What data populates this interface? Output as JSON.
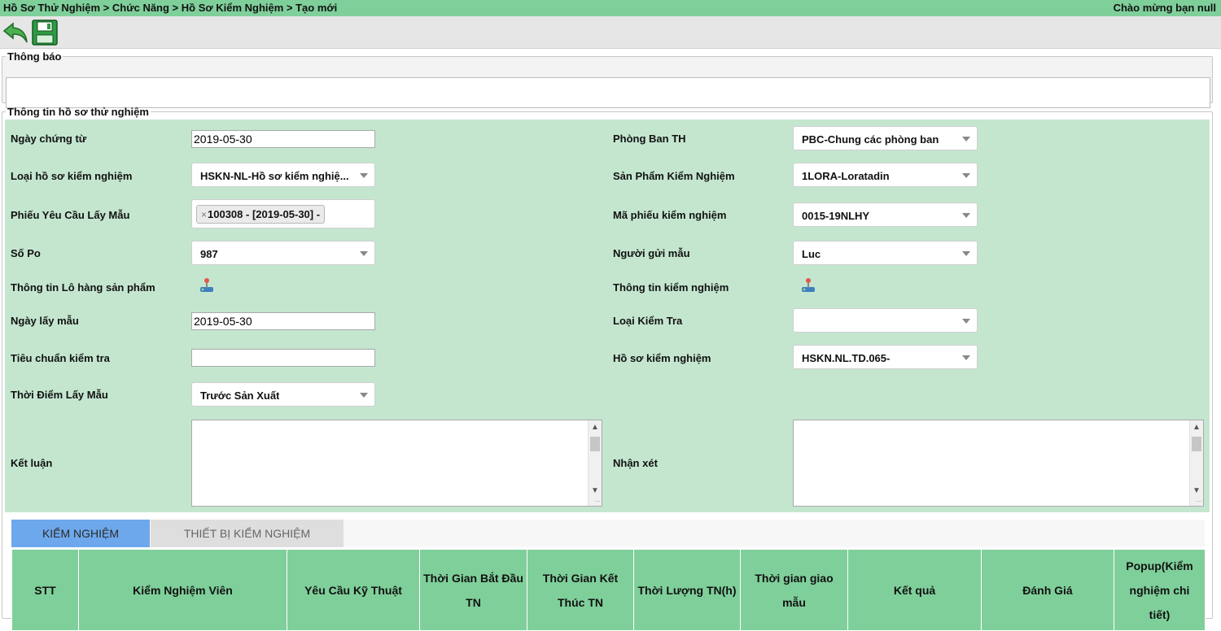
{
  "header": {
    "breadcrumb": "Hồ Sơ Thử Nghiệm > Chức Năng > Hồ Sơ Kiểm Nghiệm > Tạo mới",
    "welcome": "Chào mừng bạn null"
  },
  "toolbar": {
    "back_icon": "back-arrow-icon",
    "save_icon": "floppy-disk-icon"
  },
  "notice": {
    "legend": "Thông báo",
    "value": ""
  },
  "form": {
    "legend": "Thông tin hồ sơ thử nghiệm",
    "ngay_chung_tu": {
      "label": "Ngày chứng từ",
      "value": "2019-05-30"
    },
    "loai_ho_so": {
      "label": "Loại hồ sơ kiểm nghiệm",
      "value": "HSKN-NL-Hồ sơ kiểm nghiệ..."
    },
    "phieu_yeu_cau": {
      "label": "Phiếu Yêu Cầu Lấy Mẫu",
      "chip": "100308 - [2019-05-30] -",
      "chip_remove": "×"
    },
    "so_po": {
      "label": "Số Po",
      "value": "987"
    },
    "thong_tin_lo_hang": {
      "label": "Thông tin Lô hàng sản phẩm",
      "icon": "lookup-icon"
    },
    "ngay_lay_mau": {
      "label": "Ngày lấy mẫu",
      "value": "2019-05-30"
    },
    "tieu_chuan": {
      "label": "Tiêu chuẩn kiểm tra",
      "value": ""
    },
    "thoi_diem": {
      "label": "Thời Điểm Lấy Mẫu",
      "value": "Trước Sản Xuất"
    },
    "ket_luan": {
      "label": "Kết luận",
      "value": ""
    },
    "phong_ban": {
      "label": "Phòng Ban TH",
      "value": "PBC-Chung các phòng ban"
    },
    "san_pham": {
      "label": "Sản Phẩm Kiểm Nghiệm",
      "value": "1LORA-Loratadin"
    },
    "ma_phieu": {
      "label": "Mã phiếu kiểm nghiệm",
      "value": "0015-19NLHY"
    },
    "nguoi_gui": {
      "label": "Người gửi mẫu",
      "value": "Luc"
    },
    "thong_tin_kiem_nghiem": {
      "label": "Thông tin kiểm nghiệm",
      "icon": "lookup-icon"
    },
    "loai_kiem_tra": {
      "label": "Loại Kiểm Tra",
      "value": ""
    },
    "ho_so_kiem_nghiem": {
      "label": "Hồ sơ kiểm nghiệm",
      "value": "HSKN.NL.TD.065-"
    },
    "nhan_xet": {
      "label": "Nhận xét",
      "value": ""
    }
  },
  "tabs": [
    {
      "label": "KIỂM NGHIỆM",
      "active": true
    },
    {
      "label": "THIẾT BỊ KIỂM NGHIỆM",
      "active": false
    }
  ],
  "table": {
    "columns": [
      "STT",
      "Kiểm Nghiệm Viên",
      "Yêu Cầu Kỹ Thuật",
      "Thời Gian Bắt Đầu TN",
      "Thời Gian Kết Thúc TN",
      "Thời Lượng TN(h)",
      "Thời gian giao mẫu",
      "Kết quả",
      "Đánh Giá",
      "Popup(Kiểm nghiệm chi tiết)"
    ]
  },
  "colors": {
    "header_green": "#7fcf9a",
    "form_green": "#c4e6cf",
    "active_tab": "#6ea8ec"
  }
}
